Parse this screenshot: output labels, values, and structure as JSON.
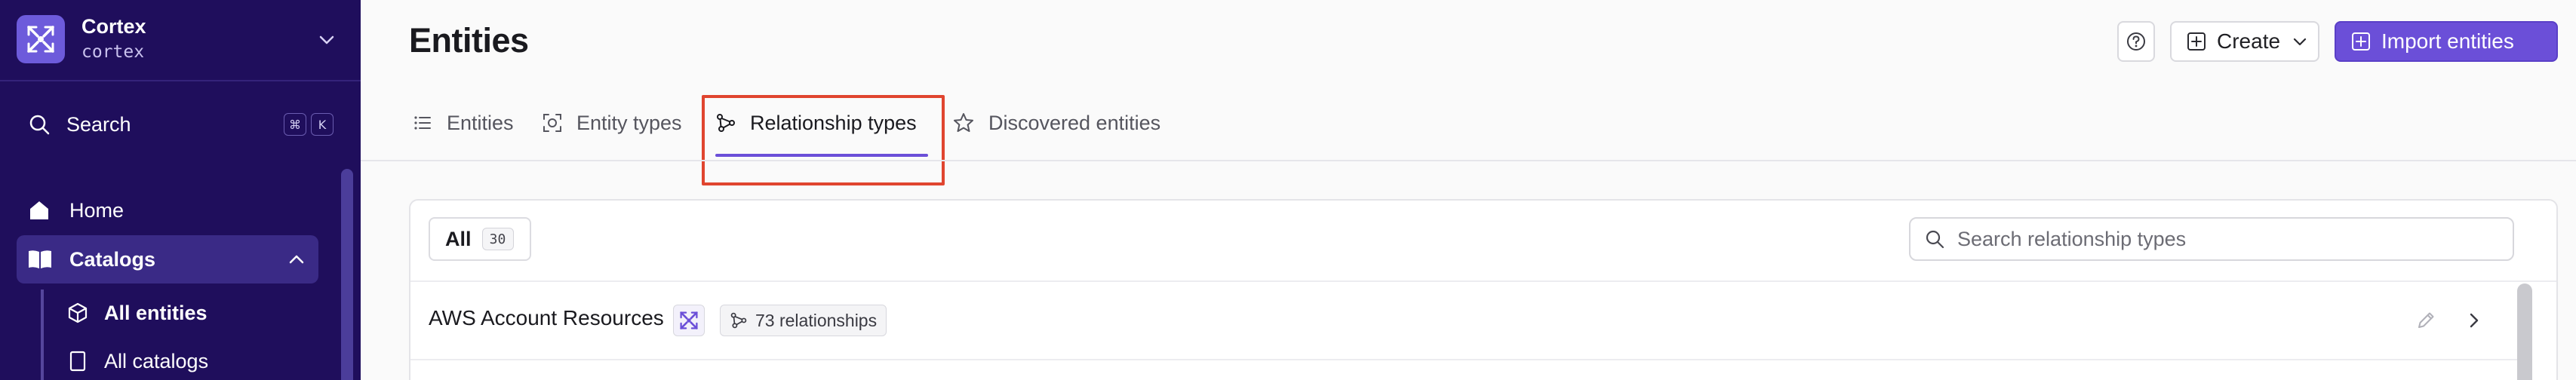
{
  "sidebar": {
    "org_name": "Cortex",
    "org_slug": "cortex",
    "search_label": "Search",
    "search_shortcut": [
      "⌘",
      "K"
    ],
    "nav": {
      "home": "Home",
      "catalogs": "Catalogs",
      "catalogs_children": [
        "All entities",
        "All catalogs"
      ]
    },
    "icons": {
      "org": "cortex-logo-icon",
      "collapse": "chevron-down-icon",
      "search": "search-icon",
      "home": "home-icon",
      "catalogs": "book-open-icon",
      "all_entities": "cube-icon",
      "all_catalogs": "book-icon"
    }
  },
  "header": {
    "title": "Entities",
    "create_label": "Create",
    "import_label": "Import entities"
  },
  "tabs": [
    {
      "label": "Entities",
      "icon": "list-icon",
      "active": false
    },
    {
      "label": "Entity types",
      "icon": "scan-icon",
      "active": false
    },
    {
      "label": "Relationship types",
      "icon": "graph-icon",
      "active": true
    },
    {
      "label": "Discovered entities",
      "icon": "star-icon",
      "active": false
    }
  ],
  "filters": {
    "all_label": "All",
    "all_count": "30"
  },
  "search": {
    "placeholder": "Search relationship types",
    "value": ""
  },
  "rows": [
    {
      "name": "AWS Account Resources",
      "relationships": "73 relationships"
    }
  ],
  "colors": {
    "sidebar_bg": "#1f0e5c",
    "accent": "#6b4fd8",
    "highlight": "#e0452f"
  }
}
